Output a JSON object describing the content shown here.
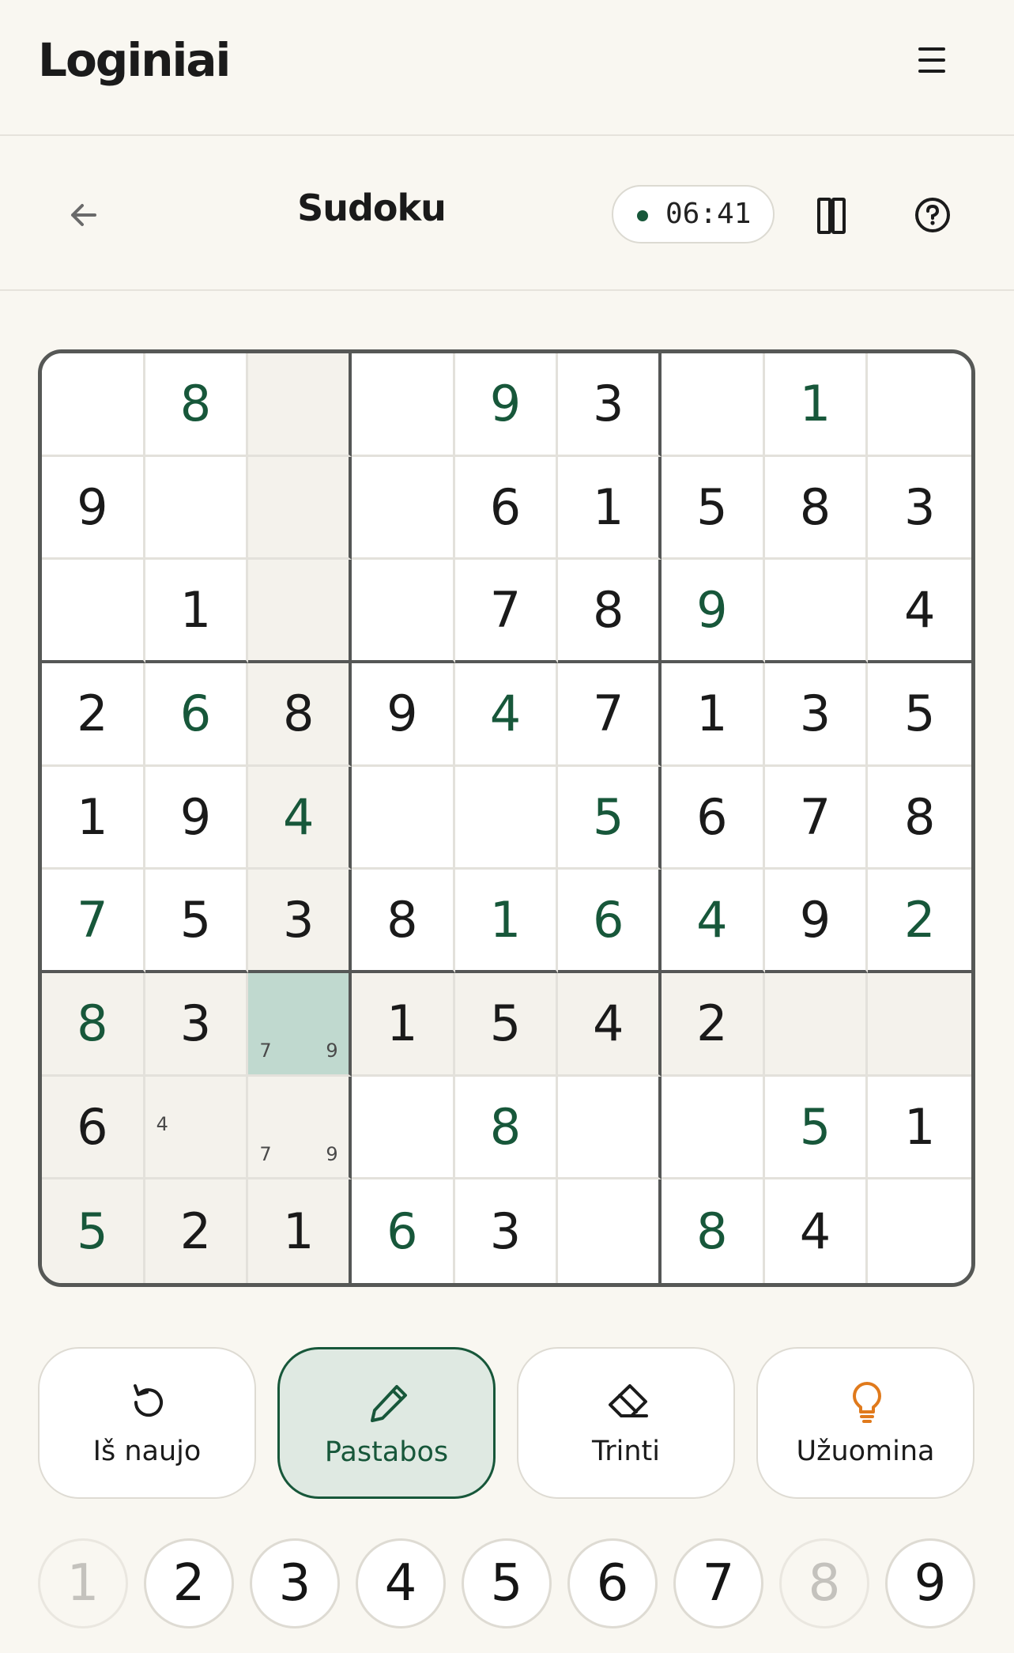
{
  "app": {
    "logo": "Loginiai"
  },
  "game": {
    "title": "Sudoku",
    "timer": "06:41"
  },
  "board": {
    "rows": [
      [
        "",
        "8",
        "",
        "",
        "9",
        "3",
        "",
        "1",
        ""
      ],
      [
        "9",
        "",
        "",
        "",
        "6",
        "1",
        "5",
        "8",
        "3"
      ],
      [
        "",
        "1",
        "",
        "",
        "7",
        "8",
        "9",
        "",
        "4"
      ],
      [
        "2",
        "6",
        "8",
        "9",
        "4",
        "7",
        "1",
        "3",
        "5"
      ],
      [
        "1",
        "9",
        "4",
        "",
        "",
        "5",
        "6",
        "7",
        "8"
      ],
      [
        "7",
        "5",
        "3",
        "8",
        "1",
        "6",
        "4",
        "9",
        "2"
      ],
      [
        "8",
        "3",
        "",
        "1",
        "5",
        "4",
        "2",
        "",
        ""
      ],
      [
        "6",
        "",
        "",
        "",
        "8",
        "",
        "",
        "5",
        "1"
      ],
      [
        "5",
        "2",
        "1",
        "6",
        "3",
        "",
        "8",
        "4",
        ""
      ]
    ],
    "user_entered": [
      [
        0,
        1
      ],
      [
        0,
        4
      ],
      [
        0,
        7
      ],
      [
        2,
        6
      ],
      [
        3,
        1
      ],
      [
        3,
        4
      ],
      [
        4,
        2
      ],
      [
        4,
        5
      ],
      [
        5,
        0
      ],
      [
        5,
        4
      ],
      [
        5,
        5
      ],
      [
        5,
        6
      ],
      [
        5,
        8
      ],
      [
        6,
        0
      ],
      [
        7,
        4
      ],
      [
        7,
        7
      ],
      [
        8,
        0
      ],
      [
        8,
        3
      ],
      [
        8,
        6
      ]
    ],
    "notes": [
      {
        "row": 6,
        "col": 2,
        "values": [
          "7",
          "9"
        ]
      },
      {
        "row": 7,
        "col": 1,
        "values": [
          "4"
        ]
      },
      {
        "row": 7,
        "col": 2,
        "values": [
          "7",
          "9"
        ]
      }
    ],
    "selected": {
      "row": 6,
      "col": 2
    }
  },
  "tools": [
    {
      "label": "Iš naujo",
      "icon": "restart-icon",
      "active": false
    },
    {
      "label": "Pastabos",
      "icon": "pencil-icon",
      "active": true
    },
    {
      "label": "Trinti",
      "icon": "eraser-icon",
      "active": false
    },
    {
      "label": "Užuomina",
      "icon": "lightbulb-icon",
      "active": false
    }
  ],
  "numpad": [
    {
      "label": "1",
      "completed": true
    },
    {
      "label": "2",
      "completed": false
    },
    {
      "label": "3",
      "completed": false
    },
    {
      "label": "4",
      "completed": false
    },
    {
      "label": "5",
      "completed": false
    },
    {
      "label": "6",
      "completed": false
    },
    {
      "label": "7",
      "completed": false
    },
    {
      "label": "8",
      "completed": true
    },
    {
      "label": "9",
      "completed": false
    }
  ],
  "colors": {
    "accent": "#17573a",
    "selected": "#c0d9cf",
    "highlight": "#f4f2ec",
    "hint": "#e07a1c"
  }
}
